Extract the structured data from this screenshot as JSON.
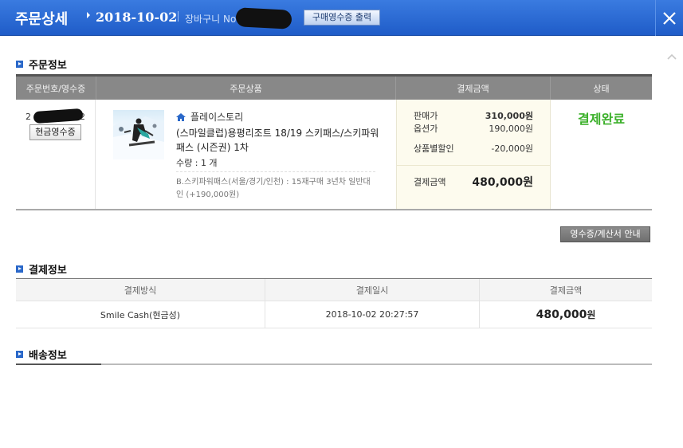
{
  "header": {
    "title": "주문상세",
    "date": "2018-10-02",
    "cart_no_label": "장바구니 No",
    "print_button": "구매영수증 출력",
    "close_icon": "close-icon"
  },
  "order_section": {
    "title": "주문정보",
    "columns": [
      "주문번호/영수증",
      "주문상품",
      "결제금액",
      "상태"
    ],
    "order_no": "2",
    "order_no_suffix": "42",
    "cash_receipt_button": "현금영수증",
    "seller": "플레이스토리",
    "product_name": "(스마일클럽)용평리조트 18/19 스키패스/스키파워패스 (시즌권) 1차",
    "quantity": "수량 : 1 개",
    "option": "B.스키파워패스(서울/경기/인천) : 15재구매 3년차 일반대인 (+190,000원)",
    "price_rows": [
      {
        "label": "판매가",
        "value": "310,000원"
      },
      {
        "label": "옵션가",
        "value": "190,000원"
      },
      {
        "label": "상품별할인",
        "value": "-20,000원"
      }
    ],
    "total_label": "결제금액",
    "total_value": "480,000원",
    "status": "결제완료",
    "status_color": "#3bb02a"
  },
  "receipt_info_button": "영수증/계산서 안내",
  "payment_section": {
    "title": "결제정보",
    "columns": [
      "결제방식",
      "결제일시",
      "결제금액"
    ],
    "method": "Smile Cash(현금성)",
    "datetime": "2018-10-02 20:27:57",
    "amount": "480,000",
    "amount_unit": "원"
  },
  "shipping_section": {
    "title": "배송정보"
  },
  "colors": {
    "header_blue": "#2a6ad6",
    "status_green": "#3bb02a"
  }
}
